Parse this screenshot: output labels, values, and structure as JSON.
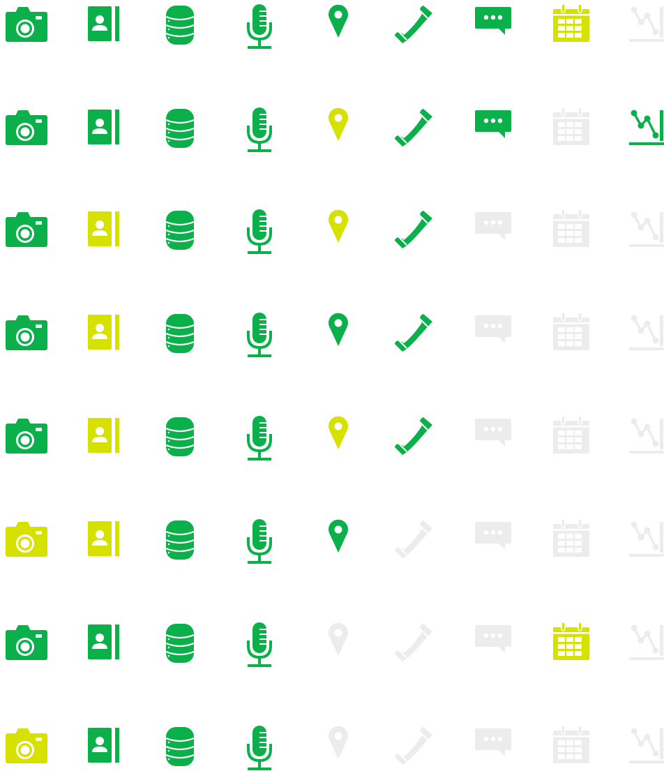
{
  "colors": {
    "green": "#0cb04a",
    "lime": "#d6e100",
    "grey": "#ececec",
    "background": "#ffffff"
  },
  "columns": [
    "camera-icon",
    "contact-book-icon",
    "database-icon",
    "microphone-icon",
    "map-pin-icon",
    "phone-icon",
    "chat-bubble-icon",
    "calendar-icon",
    "line-chart-icon"
  ],
  "rows": [
    [
      "green",
      "green",
      "green",
      "green",
      "green",
      "green",
      "green",
      "lime",
      "grey"
    ],
    [
      "green",
      "green",
      "green",
      "green",
      "lime",
      "green",
      "green",
      "grey",
      "green"
    ],
    [
      "green",
      "lime",
      "green",
      "green",
      "lime",
      "green",
      "grey",
      "grey",
      "grey"
    ],
    [
      "green",
      "lime",
      "green",
      "green",
      "green",
      "green",
      "grey",
      "grey",
      "grey"
    ],
    [
      "green",
      "lime",
      "green",
      "green",
      "lime",
      "green",
      "grey",
      "grey",
      "grey"
    ],
    [
      "lime",
      "lime",
      "green",
      "green",
      "green",
      "grey",
      "grey",
      "grey",
      "grey"
    ],
    [
      "green",
      "green",
      "green",
      "green",
      "grey",
      "grey",
      "grey",
      "lime",
      "grey"
    ],
    [
      "lime",
      "green",
      "green",
      "green",
      "grey",
      "grey",
      "grey",
      "grey",
      "grey"
    ]
  ]
}
